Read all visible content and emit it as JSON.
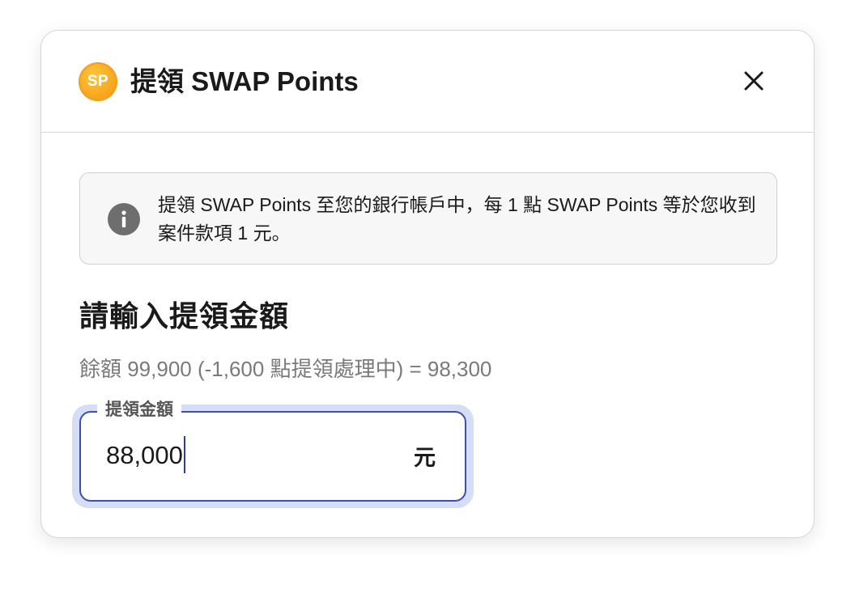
{
  "dialog": {
    "badge_text": "SP",
    "title": "提領 SWAP Points"
  },
  "info": {
    "message": "提領 SWAP Points 至您的銀行帳戶中，每 1 點 SWAP Points 等於您收到案件款項 1 元。"
  },
  "form": {
    "heading": "請輸入提領金額",
    "balance_line": "餘額 99,900 (-1,600 點提領處理中) =  98,300",
    "amount_field": {
      "label": "提領金額",
      "value": "88,000",
      "unit": "元"
    }
  },
  "colors": {
    "badge": "#f5a31a",
    "field_border": "#3d4fb0",
    "field_focus_ring": "#d6ddf6",
    "info_icon": "#6e6e6e"
  }
}
